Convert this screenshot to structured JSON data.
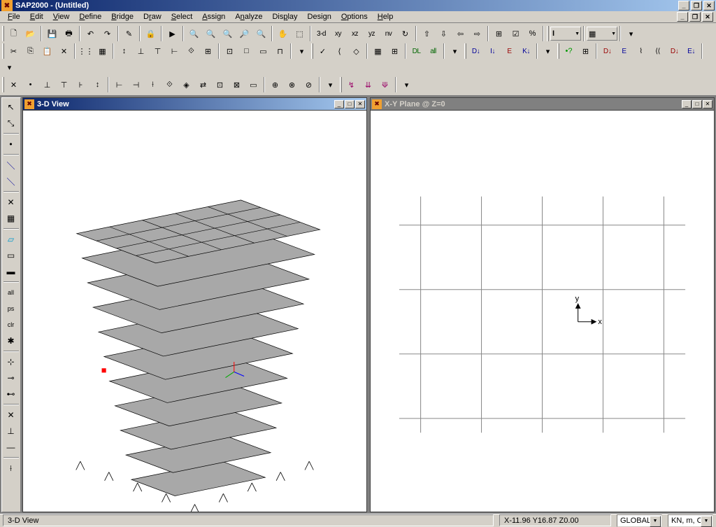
{
  "app": {
    "title": "SAP2000 - (Untitled)",
    "icon_glyph": "✖"
  },
  "menu": [
    {
      "label": "File",
      "u": "F"
    },
    {
      "label": "Edit",
      "u": "E"
    },
    {
      "label": "View",
      "u": "V"
    },
    {
      "label": "Define",
      "u": "D"
    },
    {
      "label": "Bridge",
      "u": "B"
    },
    {
      "label": "Draw",
      "u": "r",
      "pre": "D"
    },
    {
      "label": "Select",
      "u": "S"
    },
    {
      "label": "Assign",
      "u": "A"
    },
    {
      "label": "Analyze",
      "u": "n",
      "pre": "A"
    },
    {
      "label": "Display",
      "u": "p",
      "pre": "Dis"
    },
    {
      "label": "Design",
      "u": "g",
      "pre": "Desi"
    },
    {
      "label": "Options",
      "u": "O"
    },
    {
      "label": "Help",
      "u": "H"
    }
  ],
  "toolbar1": {
    "buttons": [
      "new",
      "open",
      "save",
      "print",
      "",
      "undo",
      "redo",
      "",
      "pencil",
      "",
      "lock",
      "",
      "run",
      "",
      "zoom-area",
      "zoom-prev",
      "zoom-fit",
      "zoom-in",
      "zoom-out",
      "",
      "pan",
      "toggle",
      "",
      "3d",
      "xy",
      "xz",
      "yz",
      "nv",
      "rotate",
      "",
      "up",
      "down",
      "left",
      "right",
      ""
    ],
    "text_buttons": {
      "3d": "3-d",
      "xy": "xy",
      "xz": "xz",
      "yz": "yz",
      "nv": "nv"
    }
  },
  "views": {
    "left": {
      "title": "3-D View",
      "active": true
    },
    "right": {
      "title": "X-Y Plane @ Z=0",
      "active": false
    }
  },
  "statusbar": {
    "left_text": "3-D View",
    "coords": "X-11.96  Y16.87  Z0.00",
    "coord_system": "GLOBAL",
    "units": "KN, m, C"
  },
  "axis_labels": {
    "x": "x",
    "y": "y"
  }
}
